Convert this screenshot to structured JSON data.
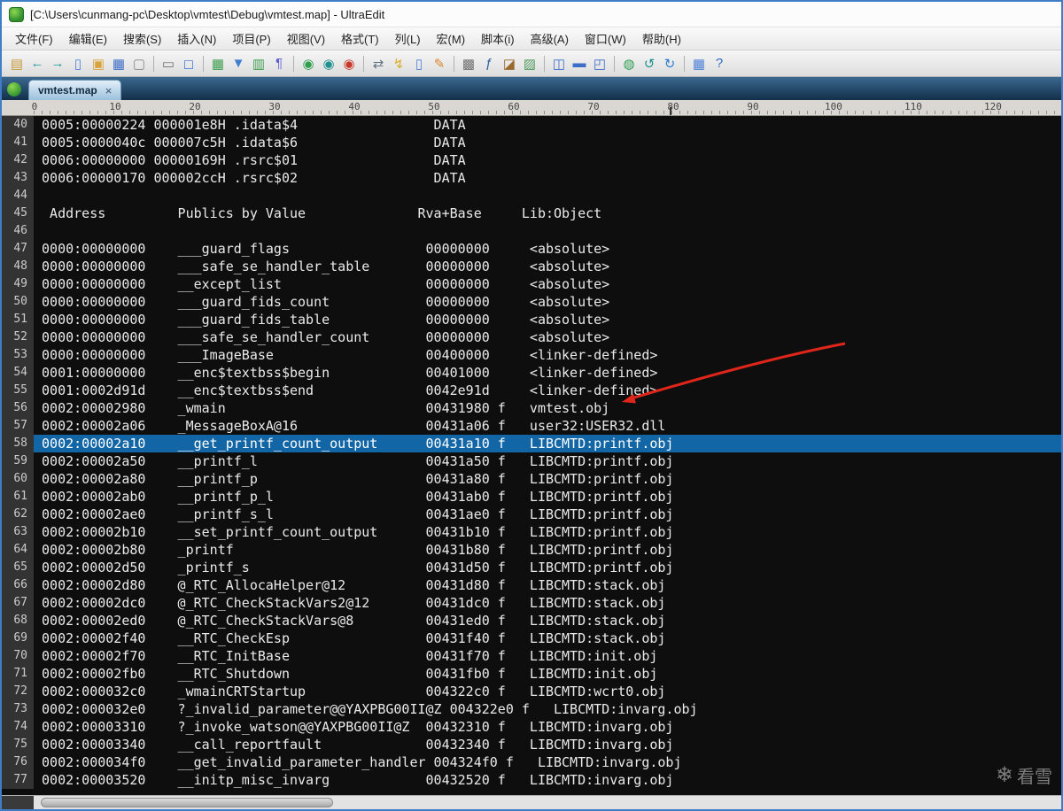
{
  "window": {
    "title": "[C:\\Users\\cunmang-pc\\Desktop\\vmtest\\Debug\\vmtest.map] - UltraEdit"
  },
  "menu": {
    "items": [
      "文件(F)",
      "编辑(E)",
      "搜索(S)",
      "插入(N)",
      "项目(P)",
      "视图(V)",
      "格式(T)",
      "列(L)",
      "宏(M)",
      "脚本(i)",
      "高级(A)",
      "窗口(W)",
      "帮助(H)"
    ]
  },
  "toolbar": {
    "groups": [
      [
        {
          "name": "paste-icon",
          "glyph": "▤",
          "color": "#c79b3c"
        },
        {
          "name": "undo-icon",
          "glyph": "←",
          "color": "#209a9a"
        },
        {
          "name": "redo-icon",
          "glyph": "→",
          "color": "#209a9a"
        },
        {
          "name": "new-file-icon",
          "glyph": "▯",
          "color": "#4f82d8"
        },
        {
          "name": "open-file-icon",
          "glyph": "▣",
          "color": "#d8a33c"
        },
        {
          "name": "save-file-icon",
          "glyph": "▦",
          "color": "#3f6ec8"
        },
        {
          "name": "close-file-icon",
          "glyph": "▢",
          "color": "#8a8a8a"
        }
      ],
      [
        {
          "name": "print-icon",
          "glyph": "▭",
          "color": "#707070"
        },
        {
          "name": "print-preview-icon",
          "glyph": "◻",
          "color": "#4f82d8"
        }
      ],
      [
        {
          "name": "spreadsheet-icon",
          "glyph": "▦",
          "color": "#3f9e4f"
        },
        {
          "name": "sort-icon",
          "glyph": "▼",
          "color": "#3f7fd0"
        },
        {
          "name": "column-mode-icon",
          "glyph": "▥",
          "color": "#3f9e4f"
        },
        {
          "name": "word-wrap-icon",
          "glyph": "¶",
          "color": "#5f5fd0"
        }
      ],
      [
        {
          "name": "browser-back-icon",
          "glyph": "◉",
          "color": "#2f9e4f"
        },
        {
          "name": "browser-globe-icon",
          "glyph": "◉",
          "color": "#209090"
        },
        {
          "name": "browser-stop-icon",
          "glyph": "◉",
          "color": "#c8382a"
        }
      ],
      [
        {
          "name": "compare-icon",
          "glyph": "⇄",
          "color": "#607080"
        },
        {
          "name": "macro-play-icon",
          "glyph": "↯",
          "color": "#d8b02f"
        },
        {
          "name": "script-icon",
          "glyph": "▯",
          "color": "#4f82d8"
        },
        {
          "name": "edit-macro-icon",
          "glyph": "✎",
          "color": "#d8862f"
        }
      ],
      [
        {
          "name": "hex-mode-icon",
          "glyph": "▩",
          "color": "#707070"
        },
        {
          "name": "function-list-icon",
          "glyph": "ƒ",
          "color": "#2f5fa0"
        },
        {
          "name": "tag-list-icon",
          "glyph": "◪",
          "color": "#9a6a2f"
        },
        {
          "name": "template-icon",
          "glyph": "▨",
          "color": "#4f9a5f"
        }
      ],
      [
        {
          "name": "split-window-icon",
          "glyph": "◫",
          "color": "#3f6ec8"
        },
        {
          "name": "tile-horizontal-icon",
          "glyph": "▬",
          "color": "#3f6ec8"
        },
        {
          "name": "cascade-windows-icon",
          "glyph": "◰",
          "color": "#3f6ec8"
        }
      ],
      [
        {
          "name": "web-preview-icon",
          "glyph": "◍",
          "color": "#2f9e4f"
        },
        {
          "name": "refresh-icon",
          "glyph": "↺",
          "color": "#209090"
        },
        {
          "name": "sync-icon",
          "glyph": "↻",
          "color": "#2f7fd0"
        }
      ],
      [
        {
          "name": "table-view-icon",
          "glyph": "▦",
          "color": "#4f82d8"
        },
        {
          "name": "help-icon",
          "glyph": "?",
          "color": "#2f6fc0"
        }
      ]
    ]
  },
  "tabs": {
    "active": {
      "label": "vmtest.map",
      "close_glyph": "×"
    }
  },
  "ruler": {
    "marks": [
      {
        "col": 0,
        "label": "0"
      },
      {
        "col": 10,
        "label": "10"
      },
      {
        "col": 20,
        "label": "20"
      },
      {
        "col": 30,
        "label": "30"
      },
      {
        "col": 40,
        "label": "40"
      },
      {
        "col": 50,
        "label": "50"
      },
      {
        "col": 60,
        "label": "60"
      },
      {
        "col": 70,
        "label": "70"
      },
      {
        "col": 80,
        "label": "80"
      },
      {
        "col": 90,
        "label": "90"
      },
      {
        "col": 100,
        "label": "100"
      },
      {
        "col": 110,
        "label": "110"
      },
      {
        "col": 120,
        "label": "120"
      }
    ],
    "margin_col": 80
  },
  "colors": {
    "selection": "#1266a6",
    "editor_bg": "#0e0e0e",
    "arrow": "#e0251a"
  },
  "editor": {
    "selected_line": 58,
    "lines": [
      {
        "num": 40,
        "type": "section",
        "addr": "0005:00000224",
        "size": "000001e8H",
        "name": ".idata$4",
        "kind": "DATA"
      },
      {
        "num": 41,
        "type": "section",
        "addr": "0005:0000040c",
        "size": "000007c5H",
        "name": ".idata$6",
        "kind": "DATA"
      },
      {
        "num": 42,
        "type": "section",
        "addr": "0006:00000000",
        "size": "00000169H",
        "name": ".rsrc$01",
        "kind": "DATA"
      },
      {
        "num": 43,
        "type": "section",
        "addr": "0006:00000170",
        "size": "000002ccH",
        "name": ".rsrc$02",
        "kind": "DATA"
      },
      {
        "num": 44,
        "type": "blank"
      },
      {
        "num": 45,
        "type": "header",
        "text": "  Address         Publics by Value              Rva+Base     Lib:Object"
      },
      {
        "num": 46,
        "type": "blank"
      },
      {
        "num": 47,
        "type": "sym",
        "addr": "0000:00000000",
        "symbol": "___guard_flags",
        "rva": "00000000",
        "lib": "<absolute>"
      },
      {
        "num": 48,
        "type": "sym",
        "addr": "0000:00000000",
        "symbol": "___safe_se_handler_table",
        "rva": "00000000",
        "lib": "<absolute>"
      },
      {
        "num": 49,
        "type": "sym",
        "addr": "0000:00000000",
        "symbol": "__except_list",
        "rva": "00000000",
        "lib": "<absolute>"
      },
      {
        "num": 50,
        "type": "sym",
        "addr": "0000:00000000",
        "symbol": "___guard_fids_count",
        "rva": "00000000",
        "lib": "<absolute>"
      },
      {
        "num": 51,
        "type": "sym",
        "addr": "0000:00000000",
        "symbol": "___guard_fids_table",
        "rva": "00000000",
        "lib": "<absolute>"
      },
      {
        "num": 52,
        "type": "sym",
        "addr": "0000:00000000",
        "symbol": "___safe_se_handler_count",
        "rva": "00000000",
        "lib": "<absolute>"
      },
      {
        "num": 53,
        "type": "sym",
        "addr": "0000:00000000",
        "symbol": "___ImageBase",
        "rva": "00400000",
        "lib": "<linker-defined>"
      },
      {
        "num": 54,
        "type": "sym",
        "addr": "0001:00000000",
        "symbol": "__enc$textbss$begin",
        "rva": "00401000",
        "lib": "<linker-defined>"
      },
      {
        "num": 55,
        "type": "sym",
        "addr": "0001:0002d91d",
        "symbol": "__enc$textbss$end",
        "rva": "0042e91d",
        "lib": "<linker-defined>"
      },
      {
        "num": 56,
        "type": "sym",
        "addr": "0002:00002980",
        "symbol": "_wmain",
        "rva": "00431980",
        "flag": "f",
        "lib": "vmtest.obj"
      },
      {
        "num": 57,
        "type": "sym",
        "addr": "0002:00002a06",
        "symbol": "_MessageBoxA@16",
        "rva": "00431a06",
        "flag": "f",
        "lib": "user32:USER32.dll"
      },
      {
        "num": 58,
        "type": "sym",
        "addr": "0002:00002a10",
        "symbol": "__get_printf_count_output",
        "rva": "00431a10",
        "flag": "f",
        "lib": "LIBCMTD:printf.obj",
        "selected": true
      },
      {
        "num": 59,
        "type": "sym",
        "addr": "0002:00002a50",
        "symbol": "__printf_l",
        "rva": "00431a50",
        "flag": "f",
        "lib": "LIBCMTD:printf.obj"
      },
      {
        "num": 60,
        "type": "sym",
        "addr": "0002:00002a80",
        "symbol": "__printf_p",
        "rva": "00431a80",
        "flag": "f",
        "lib": "LIBCMTD:printf.obj"
      },
      {
        "num": 61,
        "type": "sym",
        "addr": "0002:00002ab0",
        "symbol": "__printf_p_l",
        "rva": "00431ab0",
        "flag": "f",
        "lib": "LIBCMTD:printf.obj"
      },
      {
        "num": 62,
        "type": "sym",
        "addr": "0002:00002ae0",
        "symbol": "__printf_s_l",
        "rva": "00431ae0",
        "flag": "f",
        "lib": "LIBCMTD:printf.obj"
      },
      {
        "num": 63,
        "type": "sym",
        "addr": "0002:00002b10",
        "symbol": "__set_printf_count_output",
        "rva": "00431b10",
        "flag": "f",
        "lib": "LIBCMTD:printf.obj"
      },
      {
        "num": 64,
        "type": "sym",
        "addr": "0002:00002b80",
        "symbol": "_printf",
        "rva": "00431b80",
        "flag": "f",
        "lib": "LIBCMTD:printf.obj"
      },
      {
        "num": 65,
        "type": "sym",
        "addr": "0002:00002d50",
        "symbol": "_printf_s",
        "rva": "00431d50",
        "flag": "f",
        "lib": "LIBCMTD:printf.obj"
      },
      {
        "num": 66,
        "type": "sym",
        "addr": "0002:00002d80",
        "symbol": "@_RTC_AllocaHelper@12",
        "rva": "00431d80",
        "flag": "f",
        "lib": "LIBCMTD:stack.obj"
      },
      {
        "num": 67,
        "type": "sym",
        "addr": "0002:00002dc0",
        "symbol": "@_RTC_CheckStackVars2@12",
        "rva": "00431dc0",
        "flag": "f",
        "lib": "LIBCMTD:stack.obj"
      },
      {
        "num": 68,
        "type": "sym",
        "addr": "0002:00002ed0",
        "symbol": "@_RTC_CheckStackVars@8",
        "rva": "00431ed0",
        "flag": "f",
        "lib": "LIBCMTD:stack.obj"
      },
      {
        "num": 69,
        "type": "sym",
        "addr": "0002:00002f40",
        "symbol": "__RTC_CheckEsp",
        "rva": "00431f40",
        "flag": "f",
        "lib": "LIBCMTD:stack.obj"
      },
      {
        "num": 70,
        "type": "sym",
        "addr": "0002:00002f70",
        "symbol": "__RTC_InitBase",
        "rva": "00431f70",
        "flag": "f",
        "lib": "LIBCMTD:init.obj"
      },
      {
        "num": 71,
        "type": "sym",
        "addr": "0002:00002fb0",
        "symbol": "__RTC_Shutdown",
        "rva": "00431fb0",
        "flag": "f",
        "lib": "LIBCMTD:init.obj"
      },
      {
        "num": 72,
        "type": "sym",
        "addr": "0002:000032c0",
        "symbol": "_wmainCRTStartup",
        "rva": "004322c0",
        "flag": "f",
        "lib": "LIBCMTD:wcrt0.obj"
      },
      {
        "num": 73,
        "type": "sym",
        "addr": "0002:000032e0",
        "symbol": "?_invalid_parameter@@YAXPBG00II@Z",
        "rva": "004322e0",
        "flag": "f",
        "lib": "LIBCMTD:invarg.obj"
      },
      {
        "num": 74,
        "type": "sym",
        "addr": "0002:00003310",
        "symbol": "?_invoke_watson@@YAXPBG00II@Z",
        "rva": "00432310",
        "flag": "f",
        "lib": "LIBCMTD:invarg.obj"
      },
      {
        "num": 75,
        "type": "sym",
        "addr": "0002:00003340",
        "symbol": "__call_reportfault",
        "rva": "00432340",
        "flag": "f",
        "lib": "LIBCMTD:invarg.obj"
      },
      {
        "num": 76,
        "type": "sym",
        "addr": "0002:000034f0",
        "symbol": "__get_invalid_parameter_handler",
        "rva": "004324f0",
        "flag": "f",
        "lib": "LIBCMTD:invarg.obj"
      },
      {
        "num": 77,
        "type": "sym",
        "addr": "0002:00003520",
        "symbol": "__initp_misc_invarg",
        "rva": "00432520",
        "flag": "f",
        "lib": "LIBCMTD:invarg.obj"
      }
    ]
  },
  "watermark": {
    "icon": "❄",
    "text": "看雪"
  }
}
